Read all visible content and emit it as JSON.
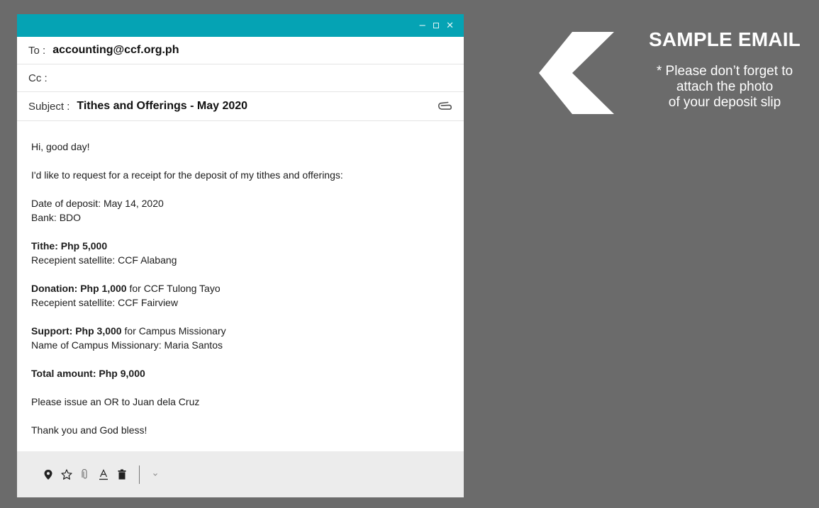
{
  "window": {
    "controls": {
      "minimize": "−",
      "close": "✕"
    }
  },
  "email": {
    "to_label": "To :",
    "to_value": "accounting@ccf.org.ph",
    "cc_label": "Cc :",
    "cc_value": "",
    "subject_label": "Subject :",
    "subject_value": "Tithes and Offerings - May 2020",
    "body": {
      "greeting": "Hi, good day!",
      "request": "I'd like to request for a receipt for the deposit of my tithes and offerings:",
      "date_of_deposit": "Date of deposit: May 14, 2020",
      "bank": "Bank: BDO",
      "tithe_bold": "Tithe: Php 5,000",
      "tithe_satellite": "Recepient satellite: CCF Alabang",
      "donation_bold": "Donation: Php 1,000",
      "donation_rest": " for CCF Tulong Tayo",
      "donation_satellite": "Recepient satellite: CCF Fairview",
      "support_bold": "Support: Php 3,000",
      "support_rest": " for Campus Missionary",
      "support_name": "Name of Campus Missionary: Maria Santos",
      "total_bold": "Total amount: Php 9,000",
      "issue_or": "Please issue an OR to Juan dela Cruz",
      "closing": "Thank you and God bless!"
    }
  },
  "toolbar": {
    "icons": [
      "location-pin-icon",
      "star-icon",
      "attachment-icon",
      "text-format-icon",
      "trash-icon",
      "chevron-down-icon"
    ]
  },
  "annotation": {
    "title": "SAMPLE EMAIL",
    "note_line1": "* Please don’t forget to",
    "note_line2": "attach the photo",
    "note_line3": "of your deposit slip"
  },
  "colors": {
    "background": "#6b6b6b",
    "titlebar": "#05a3b4",
    "toolbar": "#ececec"
  }
}
